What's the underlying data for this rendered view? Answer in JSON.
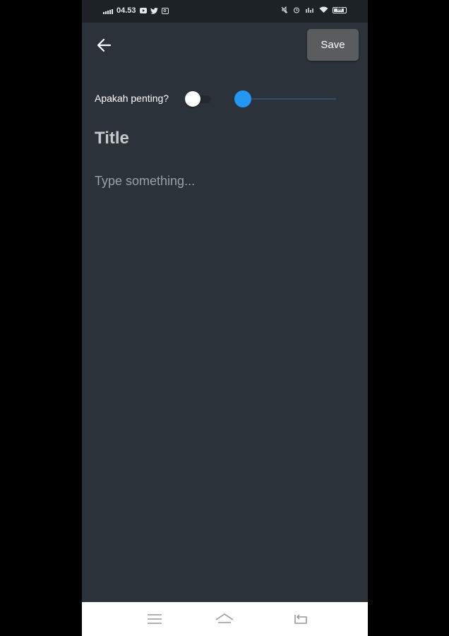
{
  "status_bar": {
    "time": "04.53",
    "battery": "86",
    "left_icons": [
      "signal-icon",
      "youtube-icon",
      "twitter-icon",
      "instagram-icon"
    ],
    "right_icons": [
      "mute-icon",
      "alarm-icon",
      "data-icon",
      "wifi-icon",
      "battery-icon"
    ]
  },
  "toolbar": {
    "back_icon": "arrow-left-icon",
    "save_label": "Save"
  },
  "form": {
    "important_label": "Apakah penting?",
    "important_on": false,
    "priority_value": 0,
    "title_placeholder": "Title",
    "description_placeholder": "Type something..."
  },
  "nav": {
    "icons": [
      "menu-icon",
      "home-icon",
      "back-icon"
    ]
  },
  "colors": {
    "background": "#2b3239",
    "accent": "#2196f3",
    "save_button": "#5a5d60"
  }
}
